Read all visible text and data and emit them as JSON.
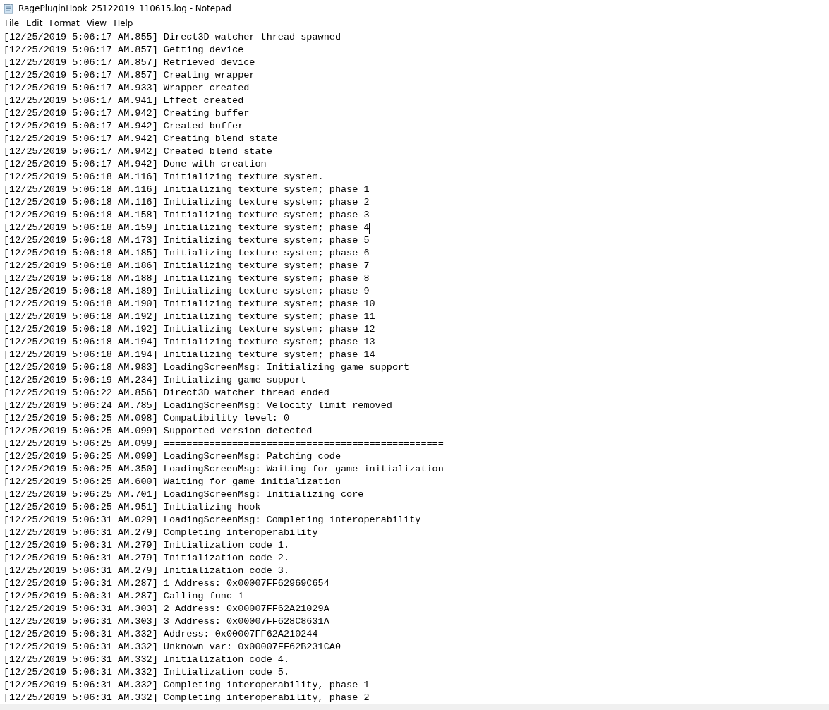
{
  "window": {
    "title": "RagePluginHook_25122019_110615.log - Notepad"
  },
  "menu": [
    "File",
    "Edit",
    "Format",
    "View",
    "Help"
  ],
  "lines": [
    {
      "text": "[12/25/2019 5:06:17 AM.855] Direct3D watcher thread spawned",
      "caret": false
    },
    {
      "text": "[12/25/2019 5:06:17 AM.857] Getting device",
      "caret": false
    },
    {
      "text": "[12/25/2019 5:06:17 AM.857] Retrieved device",
      "caret": false
    },
    {
      "text": "[12/25/2019 5:06:17 AM.857] Creating wrapper",
      "caret": false
    },
    {
      "text": "[12/25/2019 5:06:17 AM.933] Wrapper created",
      "caret": false
    },
    {
      "text": "[12/25/2019 5:06:17 AM.941] Effect created",
      "caret": false
    },
    {
      "text": "[12/25/2019 5:06:17 AM.942] Creating buffer",
      "caret": false
    },
    {
      "text": "[12/25/2019 5:06:17 AM.942] Created buffer",
      "caret": false
    },
    {
      "text": "[12/25/2019 5:06:17 AM.942] Creating blend state",
      "caret": false
    },
    {
      "text": "[12/25/2019 5:06:17 AM.942] Created blend state",
      "caret": false
    },
    {
      "text": "[12/25/2019 5:06:17 AM.942] Done with creation",
      "caret": false
    },
    {
      "text": "[12/25/2019 5:06:18 AM.116] Initializing texture system.",
      "caret": false
    },
    {
      "text": "[12/25/2019 5:06:18 AM.116] Initializing texture system; phase 1",
      "caret": false
    },
    {
      "text": "[12/25/2019 5:06:18 AM.116] Initializing texture system; phase 2",
      "caret": false
    },
    {
      "text": "[12/25/2019 5:06:18 AM.158] Initializing texture system; phase 3",
      "caret": false
    },
    {
      "text": "[12/25/2019 5:06:18 AM.159] Initializing texture system; phase 4",
      "caret": true
    },
    {
      "text": "[12/25/2019 5:06:18 AM.173] Initializing texture system; phase 5",
      "caret": false
    },
    {
      "text": "[12/25/2019 5:06:18 AM.185] Initializing texture system; phase 6",
      "caret": false
    },
    {
      "text": "[12/25/2019 5:06:18 AM.186] Initializing texture system; phase 7",
      "caret": false
    },
    {
      "text": "[12/25/2019 5:06:18 AM.188] Initializing texture system; phase 8",
      "caret": false
    },
    {
      "text": "[12/25/2019 5:06:18 AM.189] Initializing texture system; phase 9",
      "caret": false
    },
    {
      "text": "[12/25/2019 5:06:18 AM.190] Initializing texture system; phase 10",
      "caret": false
    },
    {
      "text": "[12/25/2019 5:06:18 AM.192] Initializing texture system; phase 11",
      "caret": false
    },
    {
      "text": "[12/25/2019 5:06:18 AM.192] Initializing texture system; phase 12",
      "caret": false
    },
    {
      "text": "[12/25/2019 5:06:18 AM.194] Initializing texture system; phase 13",
      "caret": false
    },
    {
      "text": "[12/25/2019 5:06:18 AM.194] Initializing texture system; phase 14",
      "caret": false
    },
    {
      "text": "[12/25/2019 5:06:18 AM.983] LoadingScreenMsg: Initializing game support",
      "caret": false
    },
    {
      "text": "[12/25/2019 5:06:19 AM.234] Initializing game support",
      "caret": false
    },
    {
      "text": "[12/25/2019 5:06:22 AM.856] Direct3D watcher thread ended",
      "caret": false
    },
    {
      "text": "[12/25/2019 5:06:24 AM.785] LoadingScreenMsg: Velocity limit removed",
      "caret": false
    },
    {
      "text": "[12/25/2019 5:06:25 AM.098] Compatibility level: 0",
      "caret": false
    },
    {
      "text": "[12/25/2019 5:06:25 AM.099] Supported version detected",
      "caret": false
    },
    {
      "text": "[12/25/2019 5:06:25 AM.099] =================================================",
      "caret": false
    },
    {
      "text": "[12/25/2019 5:06:25 AM.099] LoadingScreenMsg: Patching code",
      "caret": false
    },
    {
      "text": "[12/25/2019 5:06:25 AM.350] LoadingScreenMsg: Waiting for game initialization",
      "caret": false
    },
    {
      "text": "[12/25/2019 5:06:25 AM.600] Waiting for game initialization",
      "caret": false
    },
    {
      "text": "[12/25/2019 5:06:25 AM.701] LoadingScreenMsg: Initializing core",
      "caret": false
    },
    {
      "text": "[12/25/2019 5:06:25 AM.951] Initializing hook",
      "caret": false
    },
    {
      "text": "[12/25/2019 5:06:31 AM.029] LoadingScreenMsg: Completing interoperability",
      "caret": false
    },
    {
      "text": "[12/25/2019 5:06:31 AM.279] Completing interoperability",
      "caret": false
    },
    {
      "text": "[12/25/2019 5:06:31 AM.279] Initialization code 1.",
      "caret": false
    },
    {
      "text": "[12/25/2019 5:06:31 AM.279] Initialization code 2.",
      "caret": false
    },
    {
      "text": "[12/25/2019 5:06:31 AM.279] Initialization code 3.",
      "caret": false
    },
    {
      "text": "[12/25/2019 5:06:31 AM.287] 1 Address: 0x00007FF62969C654",
      "caret": false
    },
    {
      "text": "[12/25/2019 5:06:31 AM.287] Calling func 1",
      "caret": false
    },
    {
      "text": "[12/25/2019 5:06:31 AM.303] 2 Address: 0x00007FF62A21029A",
      "caret": false
    },
    {
      "text": "[12/25/2019 5:06:31 AM.303] 3 Address: 0x00007FF628C8631A",
      "caret": false
    },
    {
      "text": "[12/25/2019 5:06:31 AM.332] Address: 0x00007FF62A210244",
      "caret": false
    },
    {
      "text": "[12/25/2019 5:06:31 AM.332] Unknown var: 0x00007FF62B231CA0",
      "caret": false
    },
    {
      "text": "[12/25/2019 5:06:31 AM.332] Initialization code 4.",
      "caret": false
    },
    {
      "text": "[12/25/2019 5:06:31 AM.332] Initialization code 5.",
      "caret": false
    },
    {
      "text": "[12/25/2019 5:06:31 AM.332] Completing interoperability, phase 1",
      "caret": false
    },
    {
      "text": "[12/25/2019 5:06:31 AM.332] Completing interoperability, phase 2",
      "caret": false
    }
  ]
}
